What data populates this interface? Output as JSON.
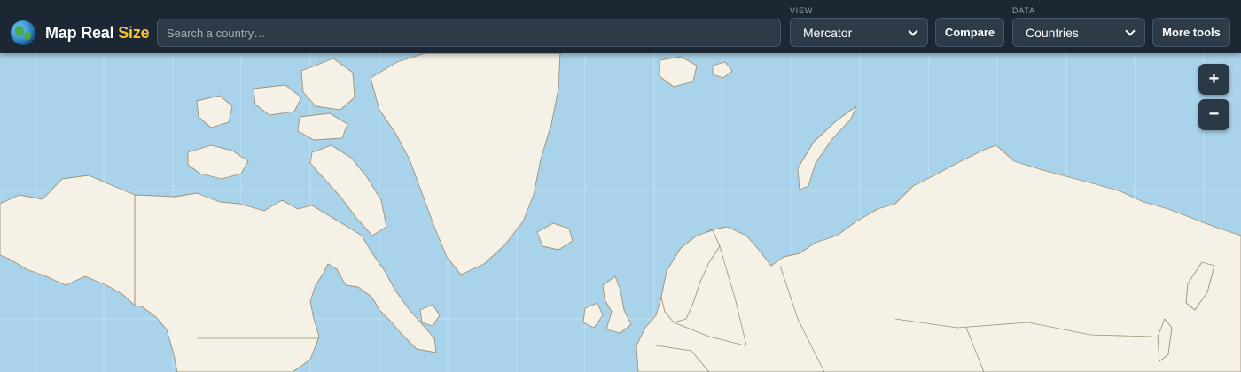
{
  "app": {
    "title_main": "Map Real ",
    "title_accent": "Size",
    "logo_icon": "globe-icon",
    "accent_color": "#f4c430"
  },
  "search": {
    "placeholder": "Search a country…",
    "value": ""
  },
  "view": {
    "label": "VIEW",
    "selected": "Mercator"
  },
  "compare_label": "Compare",
  "data_selector": {
    "label": "DATA",
    "selected": "Countries"
  },
  "more_tools_label": "More tools",
  "zoom": {
    "in_label": "+",
    "out_label": "−"
  },
  "colors": {
    "ocean": "#a9d3ea",
    "land": "#f5f1e6",
    "border": "#9d9277",
    "toolbar": "#1b2733"
  }
}
